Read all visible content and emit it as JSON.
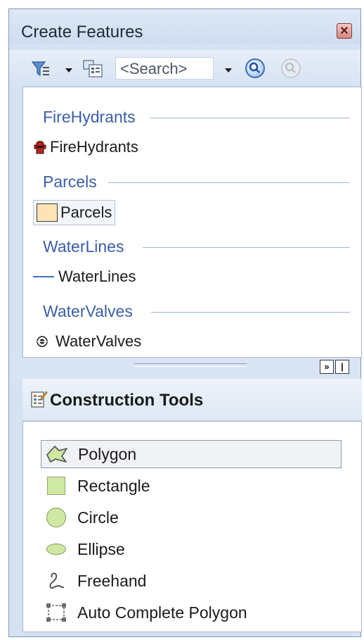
{
  "window": {
    "title": "Create Features"
  },
  "toolbar": {
    "search_placeholder": "<Search>"
  },
  "feature_groups": [
    {
      "group": "FireHydrants",
      "template": "FireHydrants",
      "icon": "fire-hydrant-icon"
    },
    {
      "group": "Parcels",
      "template": "Parcels",
      "icon": "parcel-polygon-icon",
      "selected": true
    },
    {
      "group": "WaterLines",
      "template": "WaterLines",
      "icon": "line-symbol-icon"
    },
    {
      "group": "WaterValves",
      "template": "WaterValves",
      "icon": "valve-point-icon"
    }
  ],
  "construction": {
    "title": "Construction Tools",
    "tools": [
      {
        "label": "Polygon",
        "icon": "polygon-tool-icon",
        "selected": true
      },
      {
        "label": "Rectangle",
        "icon": "rectangle-tool-icon"
      },
      {
        "label": "Circle",
        "icon": "circle-tool-icon"
      },
      {
        "label": "Ellipse",
        "icon": "ellipse-tool-icon"
      },
      {
        "label": "Freehand",
        "icon": "freehand-tool-icon"
      },
      {
        "label": "Auto Complete Polygon",
        "icon": "auto-complete-polygon-icon"
      }
    ]
  },
  "colors": {
    "group_text": "#3b5ea8",
    "parcel_fill": "#fde3b5",
    "tool_fill": "#cfe8a3"
  }
}
